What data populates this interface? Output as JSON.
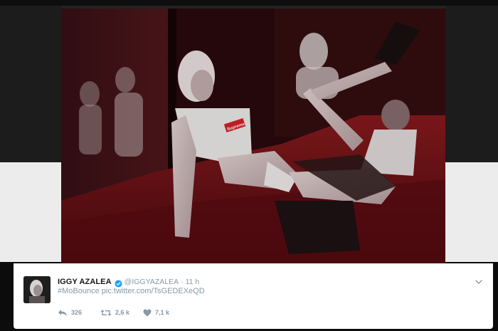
{
  "tweet": {
    "display_name": "IGGY AZALEA",
    "handle": "@IGGYAZALEA",
    "separator": "·",
    "time": "11 h",
    "hashtag": "#MoBounce",
    "link": "pic.twitter.com/TsGEDEXeQD",
    "reply_count": "326",
    "retweet_count": "2,6 k",
    "like_count": "7,1 k"
  },
  "media": {
    "shirt_text": "Supreme"
  },
  "icons": {
    "verified": "verified-badge-icon",
    "reply": "reply-arrow-icon",
    "retweet": "retweet-icon",
    "like": "heart-icon",
    "more": "chevron-down-icon"
  },
  "colors": {
    "verified": "#1da1f2",
    "muted_text": "#8899a6",
    "name_text": "#14171a",
    "brand_red": "#d8232a"
  }
}
